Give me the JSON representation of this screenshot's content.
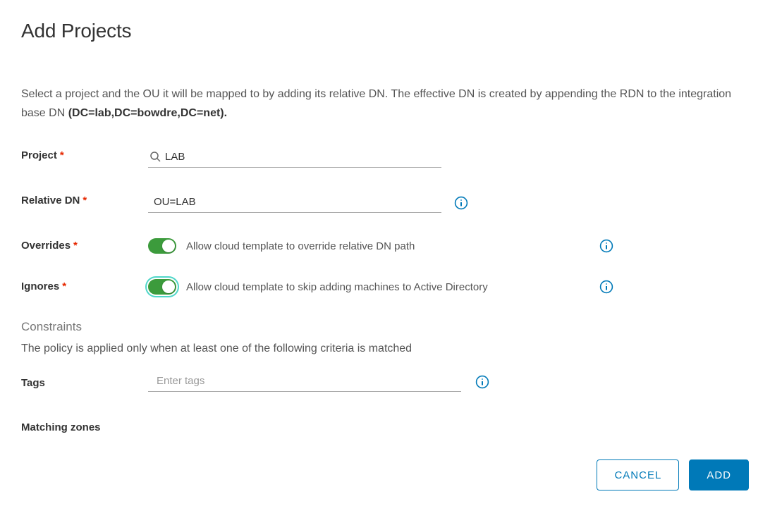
{
  "title": "Add Projects",
  "description": {
    "prefix": "Select a project and the OU it will be mapped to by adding its relative DN. The effective DN is created by appending the RDN to the integration base DN ",
    "bold": "(DC=lab,DC=bowdre,DC=net)."
  },
  "fields": {
    "project": {
      "label": "Project",
      "value": "LAB"
    },
    "relative_dn": {
      "label": "Relative DN",
      "value": "OU=LAB"
    },
    "overrides": {
      "label": "Overrides",
      "toggle_label": "Allow cloud template to override relative DN path",
      "on": true
    },
    "ignores": {
      "label": "Ignores",
      "toggle_label": "Allow cloud template to skip adding machines to Active Directory",
      "on": true
    },
    "tags": {
      "label": "Tags",
      "placeholder": "Enter tags"
    },
    "matching_zones": {
      "label": "Matching zones"
    }
  },
  "constraints": {
    "heading": "Constraints",
    "sub": "The policy is applied only when at least one of the following criteria is matched"
  },
  "buttons": {
    "cancel": "CANCEL",
    "add": "ADD"
  }
}
